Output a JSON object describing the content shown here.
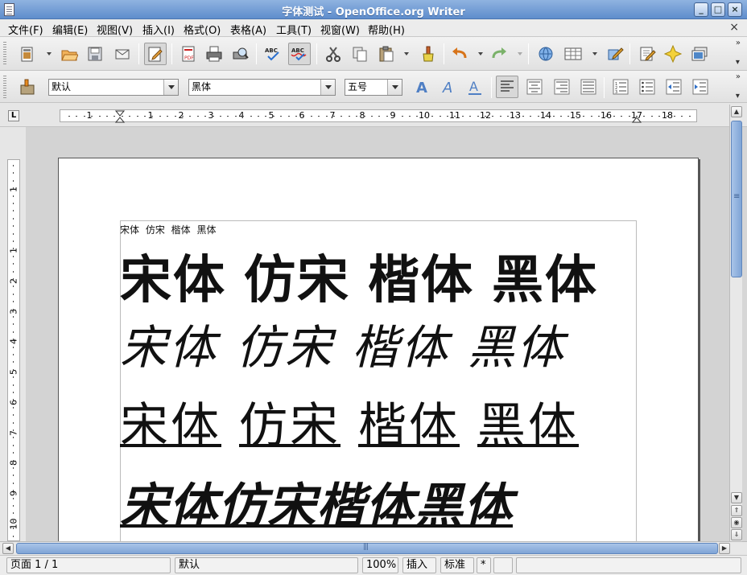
{
  "window": {
    "title": "字体测试 - OpenOffice.org Writer",
    "minimize_label": "_",
    "maximize_label": "□",
    "close_label": "×"
  },
  "menu": {
    "items": [
      "文件(F)",
      "编辑(E)",
      "视图(V)",
      "插入(I)",
      "格式(O)",
      "表格(A)",
      "工具(T)",
      "视窗(W)",
      "帮助(H)"
    ],
    "close_doc": "×"
  },
  "formatting": {
    "paragraph_style": "默认",
    "font_name": "黑体",
    "font_size": "五号"
  },
  "rulers": {
    "horizontal_labels": [
      "1",
      "1",
      "2",
      "3",
      "4",
      "5",
      "6",
      "7",
      "8",
      "9",
      "10",
      "11",
      "12",
      "13",
      "14",
      "15",
      "16",
      "17",
      "18"
    ],
    "vertical_labels": [
      "1",
      "1",
      "2",
      "3",
      "4",
      "5",
      "6",
      "7",
      "8",
      "9",
      "10"
    ],
    "tab_corner": "L"
  },
  "document": {
    "small_line": "宋体 仿宋 楷体 黑体",
    "words": [
      "宋体",
      "仿宋",
      "楷体",
      "黑体"
    ]
  },
  "statusbar": {
    "page": "页面 1 / 1",
    "style": "默认",
    "zoom": "100%",
    "insert_mode": "插入",
    "selection_mode": "标准",
    "modified": "*"
  },
  "icons": [
    "new-document-icon",
    "open-folder-icon",
    "save-icon",
    "email-icon",
    "edit-file-icon",
    "export-pdf-icon",
    "print-icon",
    "print-preview-icon",
    "spellcheck-icon",
    "autospellcheck-icon",
    "cut-icon",
    "copy-icon",
    "paste-icon",
    "format-paintbrush-icon",
    "undo-icon",
    "redo-icon",
    "hyperlink-icon",
    "table-icon",
    "show-draw-functions-icon",
    "find-replace-icon",
    "navigator-icon",
    "gallery-icon",
    "styles-icon",
    "font-color-icon",
    "align-left-icon",
    "align-center-icon",
    "align-right-icon",
    "justify-icon",
    "numbering-icon",
    "bullets-icon",
    "decrease-indent-icon",
    "increase-indent-icon"
  ],
  "colors": {
    "titlebar": "#6f98d2",
    "scroll_thumb": "#8fb0de",
    "text": "#111111"
  }
}
